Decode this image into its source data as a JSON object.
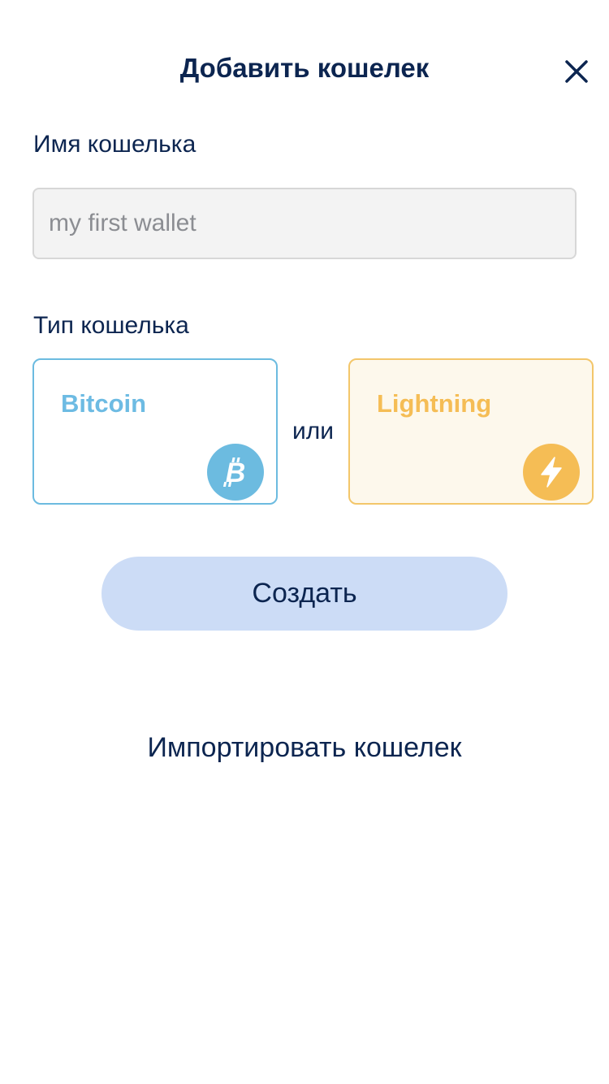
{
  "header": {
    "title": "Добавить кошелек"
  },
  "icons": {
    "close": "close-icon",
    "bitcoin": "bitcoin-icon",
    "lightning": "lightning-bolt-icon"
  },
  "form": {
    "name_label": "Имя кошелька",
    "name_value": "",
    "name_placeholder": "my first wallet",
    "type_label": "Тип кошелька",
    "types": [
      {
        "label": "Bitcoin",
        "color": "#6cbbe0"
      },
      {
        "label": "Lightning",
        "color": "#f5bd55"
      }
    ],
    "or_label": "или",
    "create_label": "Создать"
  },
  "footer": {
    "import_label": "Импортировать кошелек"
  },
  "colors": {
    "text": "#0c2550",
    "bitcoin": "#6cbbe0",
    "lightning": "#f5bd55",
    "button_bg": "#ccdcf6"
  }
}
